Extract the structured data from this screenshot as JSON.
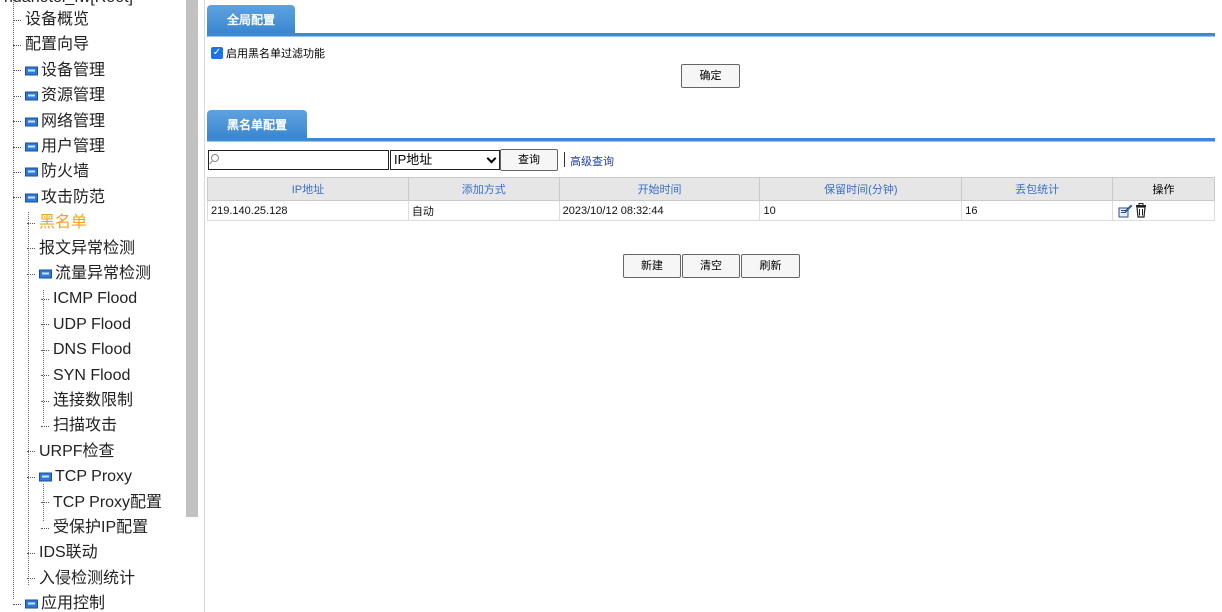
{
  "sidebar": {
    "root_label": "huahotel_fw[Root]",
    "items": [
      {
        "label": "设备概览",
        "level": 0,
        "folder": false,
        "active": false
      },
      {
        "label": "配置向导",
        "level": 0,
        "folder": false,
        "active": false
      },
      {
        "label": "设备管理",
        "level": 0,
        "folder": true,
        "active": false
      },
      {
        "label": "资源管理",
        "level": 0,
        "folder": true,
        "active": false
      },
      {
        "label": "网络管理",
        "level": 0,
        "folder": true,
        "active": false
      },
      {
        "label": "用户管理",
        "level": 0,
        "folder": true,
        "active": false
      },
      {
        "label": "防火墙",
        "level": 0,
        "folder": true,
        "active": false
      },
      {
        "label": "攻击防范",
        "level": 0,
        "folder": true,
        "active": false
      },
      {
        "label": "黑名单",
        "level": 1,
        "folder": false,
        "active": true
      },
      {
        "label": "报文异常检测",
        "level": 1,
        "folder": false,
        "active": false
      },
      {
        "label": "流量异常检测",
        "level": 1,
        "folder": true,
        "active": false
      },
      {
        "label": "ICMP Flood",
        "level": 2,
        "folder": false,
        "active": false
      },
      {
        "label": "UDP Flood",
        "level": 2,
        "folder": false,
        "active": false
      },
      {
        "label": "DNS Flood",
        "level": 2,
        "folder": false,
        "active": false
      },
      {
        "label": "SYN Flood",
        "level": 2,
        "folder": false,
        "active": false
      },
      {
        "label": "连接数限制",
        "level": 2,
        "folder": false,
        "active": false
      },
      {
        "label": "扫描攻击",
        "level": 2,
        "folder": false,
        "active": false
      },
      {
        "label": "URPF检查",
        "level": 1,
        "folder": false,
        "active": false
      },
      {
        "label": "TCP Proxy",
        "level": 1,
        "folder": true,
        "active": false
      },
      {
        "label": "TCP Proxy配置",
        "level": 2,
        "folder": false,
        "active": false
      },
      {
        "label": "受保护IP配置",
        "level": 2,
        "folder": false,
        "active": false
      },
      {
        "label": "IDS联动",
        "level": 1,
        "folder": false,
        "active": false
      },
      {
        "label": "入侵检测统计",
        "level": 1,
        "folder": false,
        "active": false
      },
      {
        "label": "应用控制",
        "level": 0,
        "folder": true,
        "active": false
      }
    ]
  },
  "global_config": {
    "tab_label": "全局配置",
    "enable_checkbox_label": "启用黑名单过滤功能",
    "enable_checked": true,
    "ok_label": "确定"
  },
  "blacklist": {
    "tab_label": "黑名单配置",
    "search_placeholder": "",
    "field_select_value": "IP地址",
    "query_label": "查询",
    "advanced_query_label": "高级查询",
    "columns": [
      "IP地址",
      "添加方式",
      "开始时间",
      "保留时间(分钟)",
      "丢包统计",
      "操作"
    ],
    "rows": [
      {
        "ip": "219.140.25.128",
        "method": "自动",
        "start": "2023/10/12 08:32:44",
        "keep": "10",
        "drops": "16"
      }
    ],
    "new_label": "新建",
    "clear_label": "清空",
    "refresh_label": "刷新"
  },
  "colors": {
    "tab_blue": "#3a86d0",
    "header_text_blue": "#3a6fc4",
    "active_orange": "#f5a21b"
  }
}
